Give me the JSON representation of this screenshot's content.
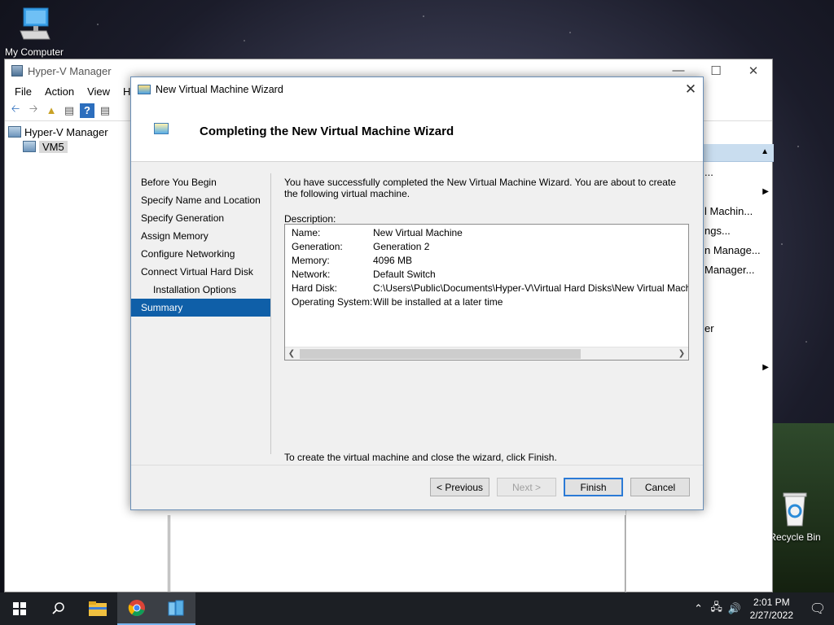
{
  "desktop": {
    "icons": [
      {
        "label": "My Computer"
      },
      {
        "label": "Recycle Bin"
      }
    ]
  },
  "manager": {
    "title": "Hyper-V Manager",
    "menu": [
      "File",
      "Action",
      "View",
      "Hel"
    ],
    "tree": {
      "root": "Hyper-V Manager",
      "child": "VM5"
    },
    "actions": [
      "...",
      "l Machin...",
      "ngs...",
      "n Manage...",
      "Manager...",
      "er"
    ]
  },
  "wizard": {
    "title": "New Virtual Machine Wizard",
    "heading": "Completing the New Virtual Machine Wizard",
    "steps": [
      {
        "label": "Before You Begin"
      },
      {
        "label": "Specify Name and Location"
      },
      {
        "label": "Specify Generation"
      },
      {
        "label": "Assign Memory"
      },
      {
        "label": "Configure Networking"
      },
      {
        "label": "Connect Virtual Hard Disk"
      },
      {
        "label": "Installation Options"
      },
      {
        "label": "Summary"
      }
    ],
    "intro": "You have successfully completed the New Virtual Machine Wizard. You are about to create the following virtual machine.",
    "description_label": "Description:",
    "description": [
      {
        "key": "Name:",
        "value": "New Virtual Machine"
      },
      {
        "key": "Generation:",
        "value": "Generation 2"
      },
      {
        "key": "Memory:",
        "value": "4096 MB"
      },
      {
        "key": "Network:",
        "value": "Default Switch"
      },
      {
        "key": "Hard Disk:",
        "value": "C:\\Users\\Public\\Documents\\Hyper-V\\Virtual Hard Disks\\New Virtual Machine.vhdx"
      },
      {
        "key": "Operating System:",
        "value": "Will be installed at a later time"
      }
    ],
    "finish_note": "To create the virtual machine and close the wizard, click Finish.",
    "buttons": {
      "previous": "< Previous",
      "next": "Next >",
      "finish": "Finish",
      "cancel": "Cancel"
    }
  },
  "taskbar": {
    "time": "2:01 PM",
    "date": "2/27/2022"
  }
}
